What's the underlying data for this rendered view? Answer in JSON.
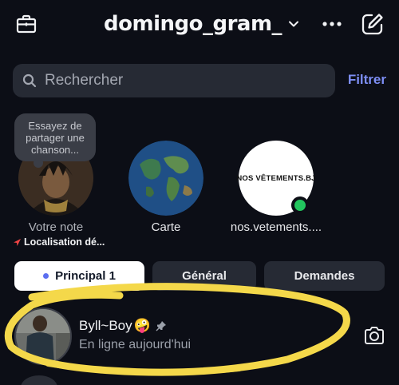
{
  "header": {
    "account_name": "domingo_gram_",
    "icons": [
      "briefcase-icon",
      "chevron-down-icon",
      "more-options-icon",
      "compose-icon"
    ]
  },
  "search": {
    "placeholder": "Rechercher",
    "filter_label": "Filtrer"
  },
  "stories": [
    {
      "label": "Votre note",
      "note_text": "Essayez de partager une chanson...",
      "sub_label": "Localisation dé..."
    },
    {
      "label": "Carte"
    },
    {
      "label": "nos.vetements....",
      "logo_text": "NOS VÊTEMENTS.BJ",
      "online": true
    }
  ],
  "tabs": [
    {
      "label": "Principal 1",
      "active": true
    },
    {
      "label": "Général",
      "active": false
    },
    {
      "label": "Demandes",
      "active": false
    }
  ],
  "conversations": [
    {
      "name": "Byll~Boy",
      "emoji": "🤪",
      "pinned": true,
      "status": "En ligne aujourd'hui"
    }
  ],
  "colors": {
    "background": "#0c0e16",
    "surface": "#262a34",
    "accent": "#7d8ef4",
    "online": "#22c55e",
    "highlight_stroke": "#f4d84a"
  }
}
